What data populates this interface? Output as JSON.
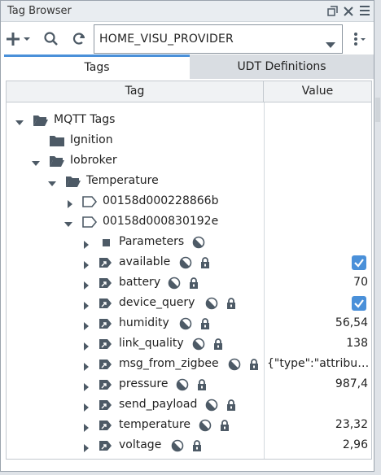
{
  "window": {
    "title": "Tag Browser"
  },
  "toolbar": {
    "provider_value": "HOME_VISU_PROVIDER"
  },
  "tabs": [
    {
      "label": "Tags",
      "active": true
    },
    {
      "label": "UDT Definitions",
      "active": false
    }
  ],
  "columns": {
    "tag": "Tag",
    "value": "Value"
  },
  "tree": {
    "mqtt_tags": "MQTT Tags",
    "ignition": "Ignition",
    "iobroker": "Iobroker",
    "temperature_folder": "Temperature",
    "device1": "00158d000228866b",
    "device2": "00158d000830192e",
    "parameters": "Parameters",
    "tags": [
      {
        "name": "available",
        "value": "",
        "checkbox": true
      },
      {
        "name": "battery",
        "value": "70",
        "checkbox": false
      },
      {
        "name": "device_query",
        "value": "",
        "checkbox": true
      },
      {
        "name": "humidity",
        "value": "56,54",
        "checkbox": false
      },
      {
        "name": "link_quality",
        "value": "138",
        "checkbox": false
      },
      {
        "name": "msg_from_zigbee",
        "value": "{\"type\":\"attribute...",
        "checkbox": false
      },
      {
        "name": "pressure",
        "value": "987,4",
        "checkbox": false
      },
      {
        "name": "send_payload",
        "value": "",
        "checkbox": false
      },
      {
        "name": "temperature",
        "value": "23,32",
        "checkbox": false
      },
      {
        "name": "voltage",
        "value": "2,96",
        "checkbox": false
      }
    ]
  },
  "colors": {
    "accent": "#4a90d9",
    "icon": "#4d5a66"
  }
}
